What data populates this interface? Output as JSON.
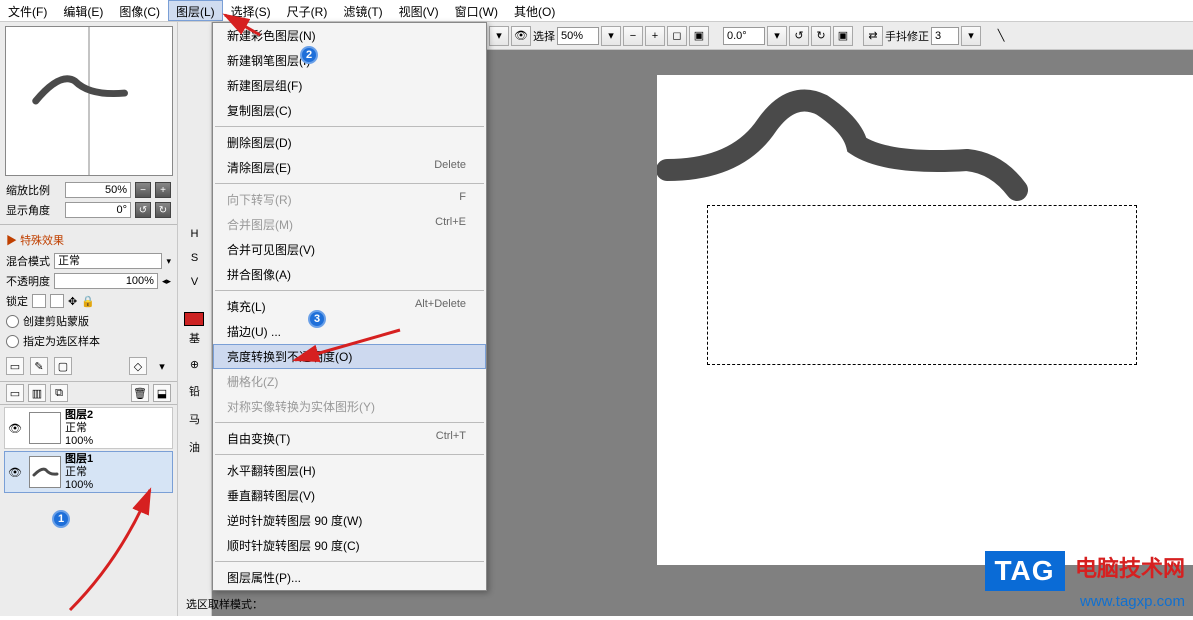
{
  "menubar": {
    "items": [
      "文件(F)",
      "编辑(E)",
      "图像(C)",
      "图层(L)",
      "选择(S)",
      "尺子(R)",
      "滤镜(T)",
      "视图(V)",
      "窗口(W)",
      "其他(O)"
    ],
    "active_index": 3
  },
  "toolbar": {
    "select_label": "选择",
    "zoom": "50%",
    "angle": "0.0°",
    "stabilizer_label": "手抖修正",
    "stabilizer_value": "3"
  },
  "left_panel": {
    "zoom_label": "缩放比例",
    "zoom_value": "50%",
    "angle_label": "显示角度",
    "angle_value": "0°",
    "effects_label": "特殊效果",
    "blend_label": "混合模式",
    "blend_value": "正常",
    "opacity_label": "不透明度",
    "opacity_value": "100%",
    "lock_label": "锁定",
    "clip_label": "创建剪贴蒙版",
    "designate_label": "指定为选区样本"
  },
  "layers": [
    {
      "name": "图层2",
      "mode": "正常",
      "opacity": "100%"
    },
    {
      "name": "图层1",
      "mode": "正常",
      "opacity": "100%"
    }
  ],
  "dropdown": {
    "items": [
      {
        "label": "新建彩色图层(N)",
        "shortcut": "",
        "enabled": true
      },
      {
        "label": "新建钢笔图层(I)",
        "shortcut": "",
        "enabled": true
      },
      {
        "label": "新建图层组(F)",
        "shortcut": "",
        "enabled": true
      },
      {
        "label": "复制图层(C)",
        "shortcut": "",
        "enabled": true
      },
      {
        "sep": true
      },
      {
        "label": "删除图层(D)",
        "shortcut": "",
        "enabled": true
      },
      {
        "label": "清除图层(E)",
        "shortcut": "Delete",
        "enabled": true
      },
      {
        "sep": true
      },
      {
        "label": "向下转写(R)",
        "shortcut": "F",
        "enabled": false
      },
      {
        "label": "合并图层(M)",
        "shortcut": "Ctrl+E",
        "enabled": false
      },
      {
        "label": "合并可见图层(V)",
        "shortcut": "",
        "enabled": true
      },
      {
        "label": "拼合图像(A)",
        "shortcut": "",
        "enabled": true
      },
      {
        "sep": true
      },
      {
        "label": "填充(L)",
        "shortcut": "Alt+Delete",
        "enabled": true
      },
      {
        "label": "描边(U) ...",
        "shortcut": "",
        "enabled": true
      },
      {
        "label": "亮度转换到不透明度(O)",
        "shortcut": "",
        "enabled": true,
        "highlighted": true
      },
      {
        "label": "栅格化(Z)",
        "shortcut": "",
        "enabled": false
      },
      {
        "label": "对称实像转换为实体图形(Y)",
        "shortcut": "",
        "enabled": false
      },
      {
        "sep": true
      },
      {
        "label": "自由变换(T)",
        "shortcut": "Ctrl+T",
        "enabled": true
      },
      {
        "sep": true
      },
      {
        "label": "水平翻转图层(H)",
        "shortcut": "",
        "enabled": true
      },
      {
        "label": "垂直翻转图层(V)",
        "shortcut": "",
        "enabled": true
      },
      {
        "label": "逆时针旋转图层 90 度(W)",
        "shortcut": "",
        "enabled": true
      },
      {
        "label": "顺时针旋转图层 90 度(C)",
        "shortcut": "",
        "enabled": true
      },
      {
        "sep": true
      },
      {
        "label": "图层属性(P)...",
        "shortcut": "",
        "enabled": true
      }
    ]
  },
  "mid_labels": [
    "H",
    "S",
    "V",
    "■",
    "基",
    "⊕",
    "铅",
    "马",
    "油"
  ],
  "bottom_label": "选区取样模式：",
  "watermark": {
    "tag": "TAG",
    "txt": "电脑技术网",
    "url": "www.tagxp.com"
  },
  "badges": {
    "b1": "1",
    "b2": "2",
    "b3": "3"
  }
}
